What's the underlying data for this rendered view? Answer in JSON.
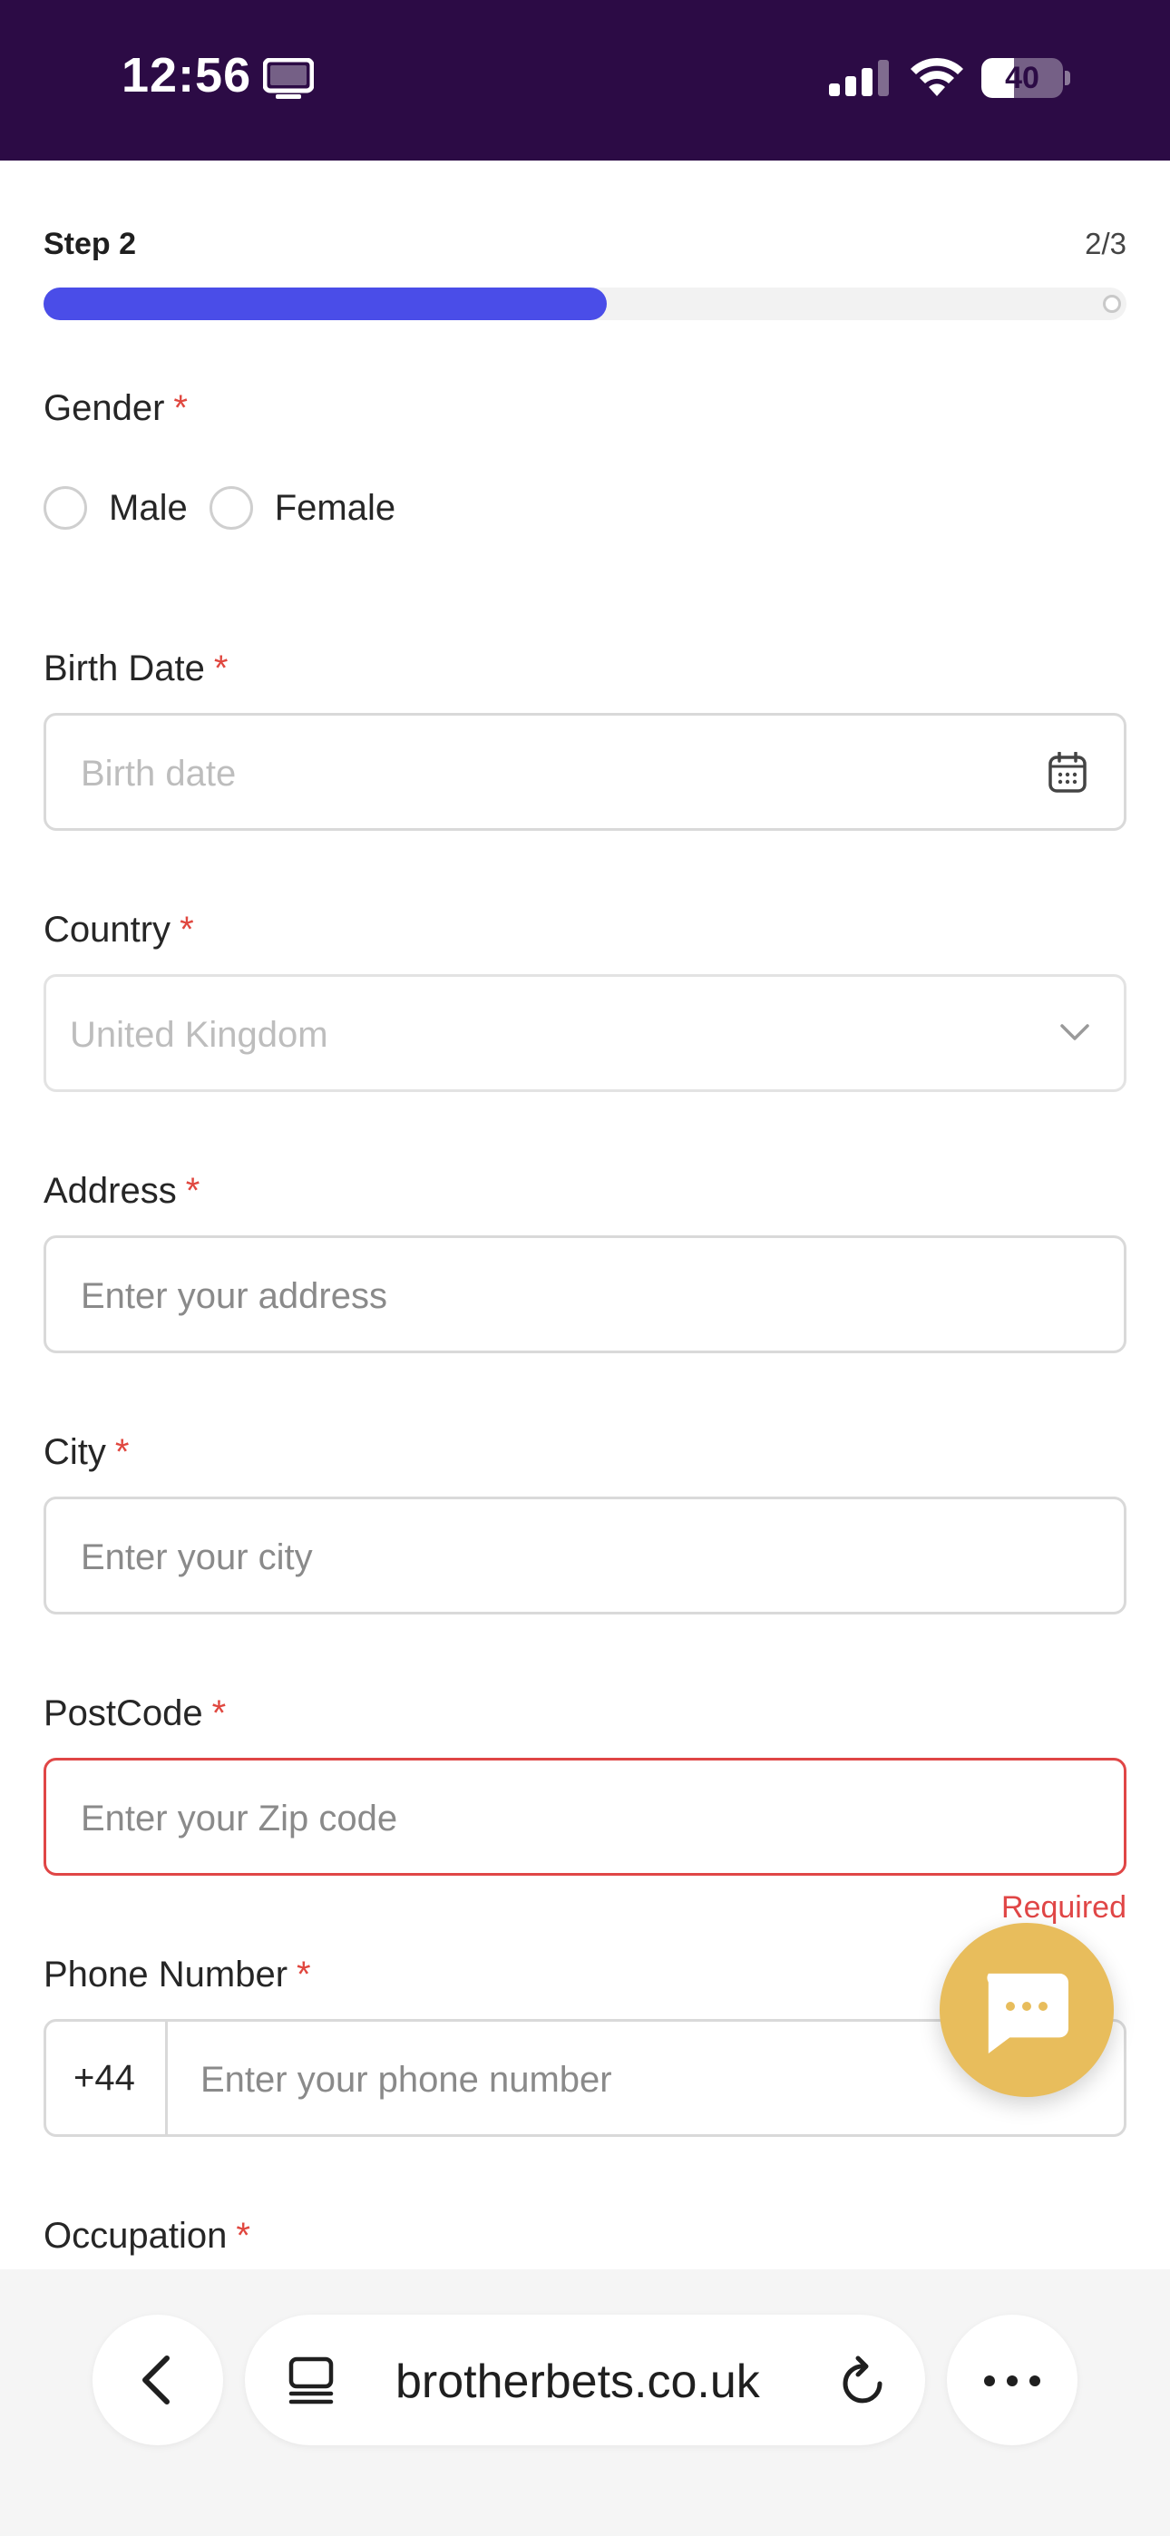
{
  "status_bar": {
    "time": "12:56",
    "battery": "40",
    "battery_level": 0.4,
    "icons": [
      "tv-icon",
      "signal-icon",
      "wifi-icon",
      "battery-icon"
    ]
  },
  "progress": {
    "step_label": "Step 2",
    "step_count": "2/3",
    "fraction": 0.52,
    "fill_color": "#4a4de8"
  },
  "form": {
    "required_mark": "*",
    "gender": {
      "label": "Gender",
      "options": [
        "Male",
        "Female"
      ]
    },
    "birth_date": {
      "label": "Birth Date",
      "placeholder": "Birth date",
      "icon": "calendar-icon"
    },
    "country": {
      "label": "Country",
      "value": "United Kingdom",
      "icon": "chevron-down-icon"
    },
    "address": {
      "label": "Address",
      "placeholder": "Enter your address"
    },
    "city": {
      "label": "City",
      "placeholder": "Enter your city"
    },
    "postcode": {
      "label": "PostCode",
      "placeholder": "Enter your Zip code",
      "error": "Required"
    },
    "phone": {
      "label": "Phone Number",
      "prefix": "+44",
      "placeholder": "Enter your phone number"
    },
    "occupation": {
      "label": "Occupation"
    }
  },
  "chat": {
    "icon": "chat-bubble-icon",
    "color": "#e8bd5c"
  },
  "browser": {
    "url": "brotherbets.co.uk",
    "icons": [
      "back-arrow-icon",
      "tabs-icon",
      "reload-icon",
      "more-icon"
    ]
  },
  "colors": {
    "status_bar_bg": "#2c0b45",
    "accent": "#4a4de8",
    "error": "#e04646"
  }
}
